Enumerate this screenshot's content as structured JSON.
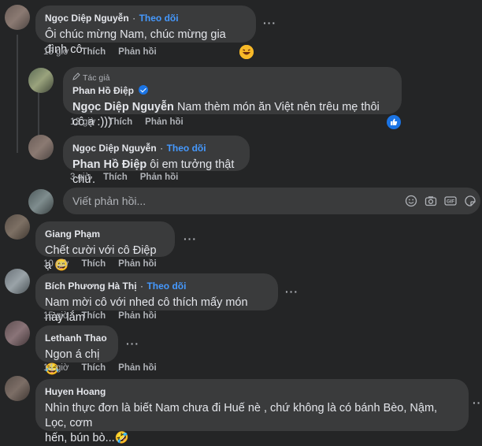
{
  "comments": [
    {
      "name": "Ngọc Diệp Nguyễn",
      "follow": "Theo dõi",
      "text": "Ôi chúc mừng Nam, chúc mừng gia đình cô",
      "time": "15 giờ",
      "like": "Thích",
      "reply": "Phản hồi",
      "reaction": "haha"
    },
    {
      "badge": "Tác giả",
      "name": "Phan Hồ Điệp",
      "tag": "Ngọc Diệp Nguyễn",
      "text": "Nam thèm món ăn Việt nên trêu mẹ thôi cô ạ :)))",
      "time": "12 giờ",
      "like": "Thích",
      "reply": "Phản hồi",
      "reaction": "like"
    },
    {
      "name": "Ngọc Diệp Nguyễn",
      "follow": "Theo dõi",
      "tag": "Phan Hồ Điệp",
      "text": "ôi em tưởng thật chứ.",
      "time": "3 giờ",
      "like": "Thích",
      "reply": "Phản hồi"
    },
    {
      "name": "Giang Phạm",
      "text": "Chết cười với cô Điệp ạ 😄",
      "time": "10 giờ",
      "like": "Thích",
      "reply": "Phản hồi"
    },
    {
      "name": "Bích Phương Hà Thị",
      "follow": "Theo dõi",
      "text": "Nam mời cô với nhed cô thích mấy món này lắm",
      "time": "15 giờ",
      "like": "Thích",
      "reply": "Phản hồi"
    },
    {
      "name": "Lethanh Thao",
      "text": "Ngon á chị 😂",
      "time": "14 giờ",
      "like": "Thích",
      "reply": "Phản hồi"
    },
    {
      "name": "Huyen Hoang",
      "text_line1": "Nhìn thực đơn là biết Nam chưa đi Huế nè , chứ không là có bánh Bèo, Nậm, Lọc, cơm",
      "text_line2": "hến, bún bò...🤣"
    }
  ],
  "reply_input": {
    "placeholder": "Viết phản hồi..."
  },
  "separator": "·",
  "more_glyph": "···",
  "icons": [
    "edit-pencil-icon",
    "verified-icon",
    "haha-reaction-icon",
    "like-reaction-icon",
    "emoji-icon",
    "camera-icon",
    "gif-icon",
    "sticker-icon"
  ],
  "colors": {
    "background": "#242526",
    "bubble": "#3a3b3c",
    "text": "#e4e6eb",
    "muted": "#b0b3b8",
    "link": "#4599ff",
    "like_blue": "#1b74e4"
  }
}
